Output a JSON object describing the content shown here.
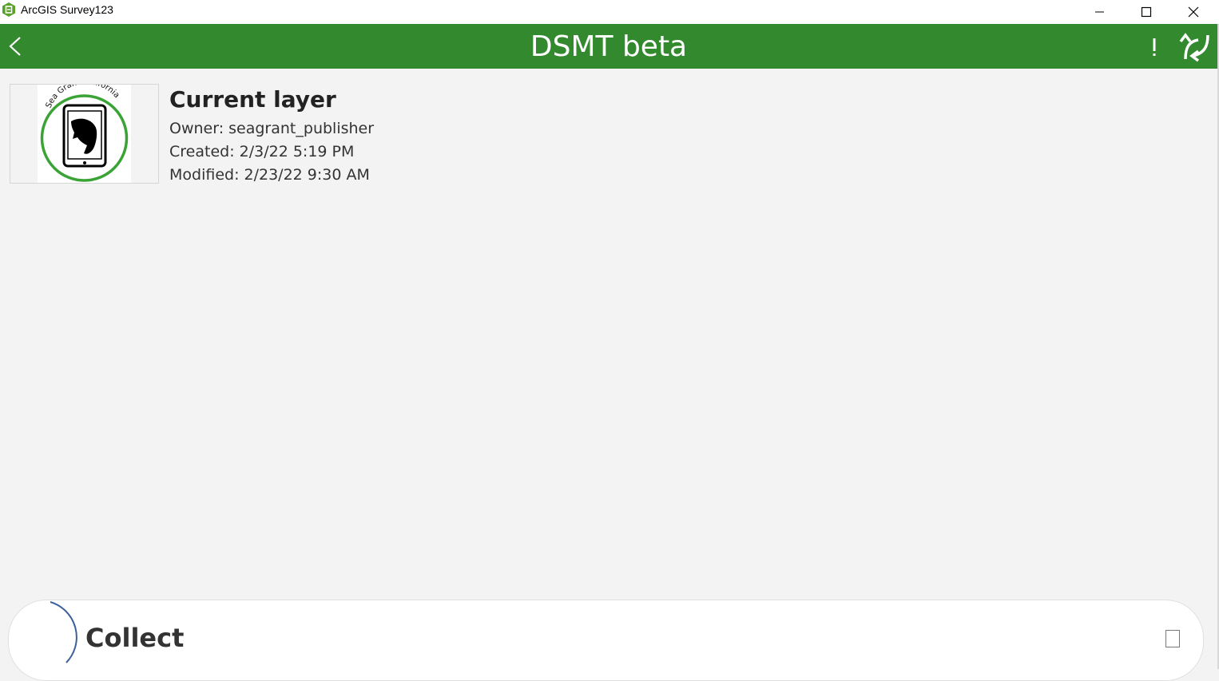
{
  "window": {
    "title": "ArcGIS Survey123"
  },
  "colors": {
    "header_green": "#338a2e",
    "background": "#f3f3f3"
  },
  "header": {
    "title": "DSMT beta",
    "icons": [
      "back-arrow-icon",
      "alert-icon",
      "sync-icon"
    ]
  },
  "survey": {
    "thumbnail_text": "Sea Grant California",
    "title": "Current layer",
    "owner": "Owner: seagrant_publisher",
    "created": "Created: 2/3/22 5:19 PM",
    "modified": "Modified: 2/23/22 9:30 AM"
  },
  "collect": {
    "label": "Collect"
  }
}
